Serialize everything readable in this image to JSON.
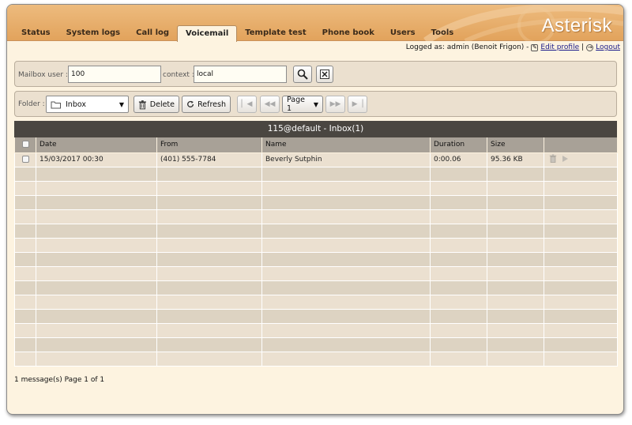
{
  "brand": "Asterisk",
  "tabs": [
    "Status",
    "System logs",
    "Call log",
    "Voicemail",
    "Template test",
    "Phone book",
    "Users",
    "Tools"
  ],
  "active_tab": "Voicemail",
  "userbar": {
    "logged_as": "Logged as: admin  (Benoit Frigon) -",
    "edit_profile": "Edit profile",
    "separator": "|",
    "logout": "Logout"
  },
  "search": {
    "mailbox_label": "Mailbox user :",
    "mailbox_value": "100",
    "context_label": "context :",
    "context_value": "local",
    "search_icon": "magnifier-icon",
    "clear_icon": "clear-x-icon"
  },
  "toolbar": {
    "folder_label": "Folder :",
    "folder_value": "Inbox",
    "delete_label": "Delete",
    "refresh_label": "Refresh",
    "page_value": "Page 1"
  },
  "grid": {
    "title": "115@default - Inbox(1)",
    "columns": [
      "Date",
      "From",
      "Name",
      "Duration",
      "Size"
    ],
    "rows": [
      {
        "date": "15/03/2017 00:30",
        "from": "(401) 555-7784",
        "name": "Beverly Sutphin",
        "duration": "0:00.06",
        "size": "95.36 KB"
      }
    ],
    "empty_rows": 14
  },
  "status_text": "1 message(s) Page 1 of 1",
  "colors": {
    "header": "#e6a968",
    "title_bar": "#4a4641",
    "table_header": "#a8a197",
    "row_odd": "#ebe0d0",
    "row_even": "#ddd3c2",
    "background": "#fdf3e0"
  }
}
